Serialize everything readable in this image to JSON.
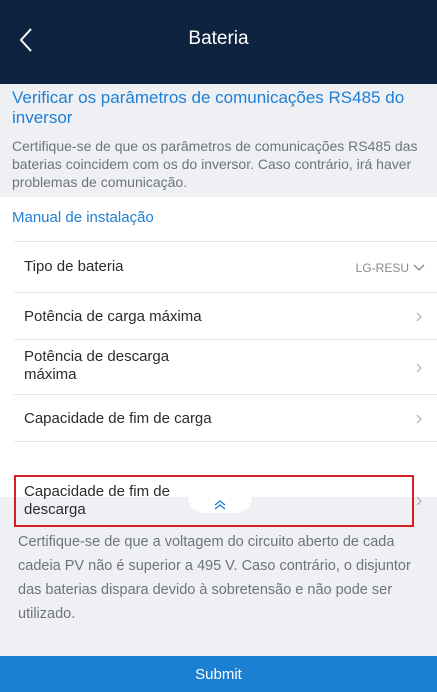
{
  "header": {
    "title": "Bateria",
    "back_icon": "chevron-left-icon"
  },
  "info": {
    "title": "Verificar os parâmetros de comunicações RS485 do inversor",
    "text": "Certifique-se de que os parâmetros de comunicações RS485 das baterias coincidem com os do inversor. Caso contrário, irá haver problemas de comunicação."
  },
  "card": {
    "manual_link": "Manual de instalação",
    "rows": [
      {
        "label": "Tipo de bateria",
        "value": "LG-RESU",
        "icon": "chevron-down-icon"
      },
      {
        "label": "Potência de carga máxima",
        "icon": "chevron-right-icon"
      },
      {
        "label": "Potência de descarga máxima",
        "icon": "chevron-right-icon"
      },
      {
        "label": "Capacidade de fim de carga",
        "icon": "chevron-right-icon"
      },
      {
        "label": "Capacidade de fim de descarga",
        "icon": "chevron-right-icon"
      }
    ],
    "collapse_icon": "double-chevron-up-icon"
  },
  "warning": {
    "text": "Certifique-se de que a voltagem do circuito aberto de cada cadeia PV não é superior a 495 V. Caso contrário, o disjuntor das baterias dispara devido à sobretensão e não pode ser utilizado."
  },
  "footer": {
    "submit_label": "Submit"
  },
  "colors": {
    "header_bg": "#0e2340",
    "accent": "#1e7fd6",
    "submit_bg": "#1b7fd2",
    "highlight_border": "#d32026"
  }
}
